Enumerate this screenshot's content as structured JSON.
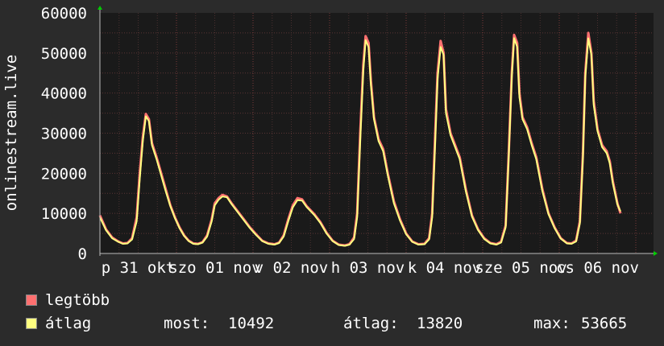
{
  "chart_data": {
    "type": "area",
    "ylabel": "onlinestream.live",
    "ylim": [
      0,
      60000
    ],
    "y_ticks": [
      0,
      10000,
      20000,
      30000,
      40000,
      50000,
      60000
    ],
    "x_tick_labels": [
      "p 31 okt",
      "szo 01 nov",
      "v 02 nov",
      "h 03 nov",
      "k 04 nov",
      "sze 05 nov",
      "cs 06 nov"
    ],
    "x_range_days": [
      0,
      7.23
    ],
    "series": [
      {
        "name": "legtöbb",
        "color": "#ff7070",
        "points": [
          [
            0.0,
            9500
          ],
          [
            0.08,
            6000
          ],
          [
            0.16,
            4000
          ],
          [
            0.24,
            3000
          ],
          [
            0.3,
            2500
          ],
          [
            0.36,
            2600
          ],
          [
            0.42,
            3800
          ],
          [
            0.48,
            9000
          ],
          [
            0.52,
            20000
          ],
          [
            0.56,
            29000
          ],
          [
            0.6,
            34800
          ],
          [
            0.64,
            33500
          ],
          [
            0.68,
            27500
          ],
          [
            0.74,
            24000
          ],
          [
            0.8,
            20000
          ],
          [
            0.86,
            16000
          ],
          [
            0.92,
            12000
          ],
          [
            0.98,
            9000
          ],
          [
            1.04,
            6500
          ],
          [
            1.1,
            4500
          ],
          [
            1.16,
            3200
          ],
          [
            1.22,
            2500
          ],
          [
            1.28,
            2400
          ],
          [
            1.34,
            2800
          ],
          [
            1.4,
            4500
          ],
          [
            1.46,
            8500
          ],
          [
            1.5,
            12500
          ],
          [
            1.55,
            13800
          ],
          [
            1.6,
            14600
          ],
          [
            1.66,
            14200
          ],
          [
            1.72,
            12500
          ],
          [
            1.8,
            10500
          ],
          [
            1.88,
            8500
          ],
          [
            1.96,
            6500
          ],
          [
            2.04,
            4800
          ],
          [
            2.12,
            3200
          ],
          [
            2.2,
            2500
          ],
          [
            2.28,
            2300
          ],
          [
            2.34,
            2700
          ],
          [
            2.4,
            4500
          ],
          [
            2.46,
            8500
          ],
          [
            2.52,
            12000
          ],
          [
            2.58,
            13800
          ],
          [
            2.64,
            13500
          ],
          [
            2.7,
            11800
          ],
          [
            2.8,
            9800
          ],
          [
            2.88,
            7800
          ],
          [
            2.96,
            5200
          ],
          [
            3.04,
            3200
          ],
          [
            3.12,
            2200
          ],
          [
            3.2,
            2000
          ],
          [
            3.26,
            2300
          ],
          [
            3.32,
            4000
          ],
          [
            3.36,
            10000
          ],
          [
            3.4,
            30000
          ],
          [
            3.44,
            47000
          ],
          [
            3.47,
            54200
          ],
          [
            3.51,
            52500
          ],
          [
            3.54,
            43000
          ],
          [
            3.58,
            34000
          ],
          [
            3.64,
            28500
          ],
          [
            3.7,
            26000
          ],
          [
            3.76,
            20000
          ],
          [
            3.84,
            13000
          ],
          [
            3.92,
            8500
          ],
          [
            4.0,
            5000
          ],
          [
            4.08,
            3000
          ],
          [
            4.16,
            2300
          ],
          [
            4.24,
            2400
          ],
          [
            4.3,
            3800
          ],
          [
            4.34,
            10000
          ],
          [
            4.38,
            30000
          ],
          [
            4.41,
            45000
          ],
          [
            4.45,
            53000
          ],
          [
            4.49,
            50000
          ],
          [
            4.52,
            36000
          ],
          [
            4.58,
            30000
          ],
          [
            4.64,
            27000
          ],
          [
            4.7,
            24000
          ],
          [
            4.78,
            16000
          ],
          [
            4.86,
            9500
          ],
          [
            4.94,
            6000
          ],
          [
            5.02,
            3800
          ],
          [
            5.1,
            2600
          ],
          [
            5.18,
            2300
          ],
          [
            5.24,
            2900
          ],
          [
            5.3,
            7000
          ],
          [
            5.34,
            25000
          ],
          [
            5.38,
            45000
          ],
          [
            5.41,
            54500
          ],
          [
            5.45,
            52500
          ],
          [
            5.48,
            40000
          ],
          [
            5.52,
            34000
          ],
          [
            5.58,
            31500
          ],
          [
            5.64,
            27500
          ],
          [
            5.7,
            24000
          ],
          [
            5.78,
            16000
          ],
          [
            5.86,
            10000
          ],
          [
            5.94,
            6500
          ],
          [
            6.02,
            3800
          ],
          [
            6.1,
            2600
          ],
          [
            6.16,
            2500
          ],
          [
            6.22,
            3200
          ],
          [
            6.27,
            8000
          ],
          [
            6.31,
            25000
          ],
          [
            6.34,
            45000
          ],
          [
            6.38,
            55000
          ],
          [
            6.42,
            50000
          ],
          [
            6.45,
            38000
          ],
          [
            6.5,
            31000
          ],
          [
            6.56,
            27000
          ],
          [
            6.62,
            25500
          ],
          [
            6.66,
            23000
          ],
          [
            6.7,
            18000
          ],
          [
            6.76,
            12500
          ],
          [
            6.8,
            10000
          ]
        ]
      },
      {
        "name": "átlag",
        "color": "#ffff80",
        "points": [
          [
            0.0,
            9000
          ],
          [
            0.08,
            5800
          ],
          [
            0.16,
            3800
          ],
          [
            0.24,
            2900
          ],
          [
            0.3,
            2400
          ],
          [
            0.36,
            2500
          ],
          [
            0.42,
            3500
          ],
          [
            0.48,
            8000
          ],
          [
            0.52,
            18500
          ],
          [
            0.56,
            28000
          ],
          [
            0.6,
            34200
          ],
          [
            0.64,
            33000
          ],
          [
            0.68,
            27000
          ],
          [
            0.74,
            23500
          ],
          [
            0.8,
            19500
          ],
          [
            0.86,
            15500
          ],
          [
            0.92,
            11800
          ],
          [
            0.98,
            8800
          ],
          [
            1.04,
            6300
          ],
          [
            1.1,
            4400
          ],
          [
            1.16,
            3100
          ],
          [
            1.22,
            2400
          ],
          [
            1.28,
            2300
          ],
          [
            1.34,
            2700
          ],
          [
            1.4,
            4200
          ],
          [
            1.46,
            8000
          ],
          [
            1.5,
            12000
          ],
          [
            1.55,
            13400
          ],
          [
            1.6,
            14200
          ],
          [
            1.66,
            14000
          ],
          [
            1.72,
            12300
          ],
          [
            1.8,
            10300
          ],
          [
            1.88,
            8300
          ],
          [
            1.96,
            6300
          ],
          [
            2.04,
            4600
          ],
          [
            2.12,
            3100
          ],
          [
            2.2,
            2400
          ],
          [
            2.28,
            2200
          ],
          [
            2.34,
            2600
          ],
          [
            2.4,
            4200
          ],
          [
            2.46,
            8000
          ],
          [
            2.52,
            11500
          ],
          [
            2.58,
            13300
          ],
          [
            2.64,
            13200
          ],
          [
            2.7,
            11600
          ],
          [
            2.8,
            9600
          ],
          [
            2.88,
            7600
          ],
          [
            2.96,
            5000
          ],
          [
            3.04,
            3100
          ],
          [
            3.12,
            2100
          ],
          [
            3.2,
            1900
          ],
          [
            3.26,
            2200
          ],
          [
            3.32,
            3600
          ],
          [
            3.36,
            9000
          ],
          [
            3.4,
            28000
          ],
          [
            3.44,
            45500
          ],
          [
            3.47,
            53200
          ],
          [
            3.51,
            51500
          ],
          [
            3.54,
            42000
          ],
          [
            3.58,
            33500
          ],
          [
            3.64,
            28000
          ],
          [
            3.7,
            25500
          ],
          [
            3.76,
            19500
          ],
          [
            3.84,
            12500
          ],
          [
            3.92,
            8200
          ],
          [
            4.0,
            4800
          ],
          [
            4.08,
            2900
          ],
          [
            4.16,
            2200
          ],
          [
            4.24,
            2300
          ],
          [
            4.3,
            3500
          ],
          [
            4.34,
            9000
          ],
          [
            4.38,
            28000
          ],
          [
            4.41,
            43500
          ],
          [
            4.45,
            51500
          ],
          [
            4.49,
            49500
          ],
          [
            4.52,
            35000
          ],
          [
            4.58,
            29500
          ],
          [
            4.64,
            26500
          ],
          [
            4.7,
            23500
          ],
          [
            4.78,
            15500
          ],
          [
            4.86,
            9200
          ],
          [
            4.94,
            5800
          ],
          [
            5.02,
            3600
          ],
          [
            5.1,
            2500
          ],
          [
            5.18,
            2200
          ],
          [
            5.24,
            2700
          ],
          [
            5.3,
            6500
          ],
          [
            5.34,
            24000
          ],
          [
            5.38,
            44000
          ],
          [
            5.41,
            53700
          ],
          [
            5.45,
            51500
          ],
          [
            5.48,
            39000
          ],
          [
            5.52,
            33500
          ],
          [
            5.58,
            31000
          ],
          [
            5.64,
            27000
          ],
          [
            5.7,
            23500
          ],
          [
            5.78,
            15500
          ],
          [
            5.86,
            9800
          ],
          [
            5.94,
            6300
          ],
          [
            6.02,
            3700
          ],
          [
            6.1,
            2500
          ],
          [
            6.16,
            2400
          ],
          [
            6.22,
            3000
          ],
          [
            6.27,
            7500
          ],
          [
            6.31,
            24000
          ],
          [
            6.34,
            44000
          ],
          [
            6.38,
            53665
          ],
          [
            6.42,
            49500
          ],
          [
            6.45,
            37000
          ],
          [
            6.5,
            30500
          ],
          [
            6.56,
            26500
          ],
          [
            6.62,
            25000
          ],
          [
            6.66,
            22500
          ],
          [
            6.7,
            17500
          ],
          [
            6.76,
            12200
          ],
          [
            6.8,
            10492
          ]
        ]
      }
    ]
  },
  "legend": {
    "max_label": "legtöbb",
    "avg_label": "átlag",
    "max_color": "#ff7070",
    "avg_color": "#ffff80"
  },
  "stats": {
    "most_label": "most:",
    "most_value": "10492",
    "atlag_label": "átlag:",
    "atlag_value": "13820",
    "max_label": "max:",
    "max_value": "53665"
  }
}
